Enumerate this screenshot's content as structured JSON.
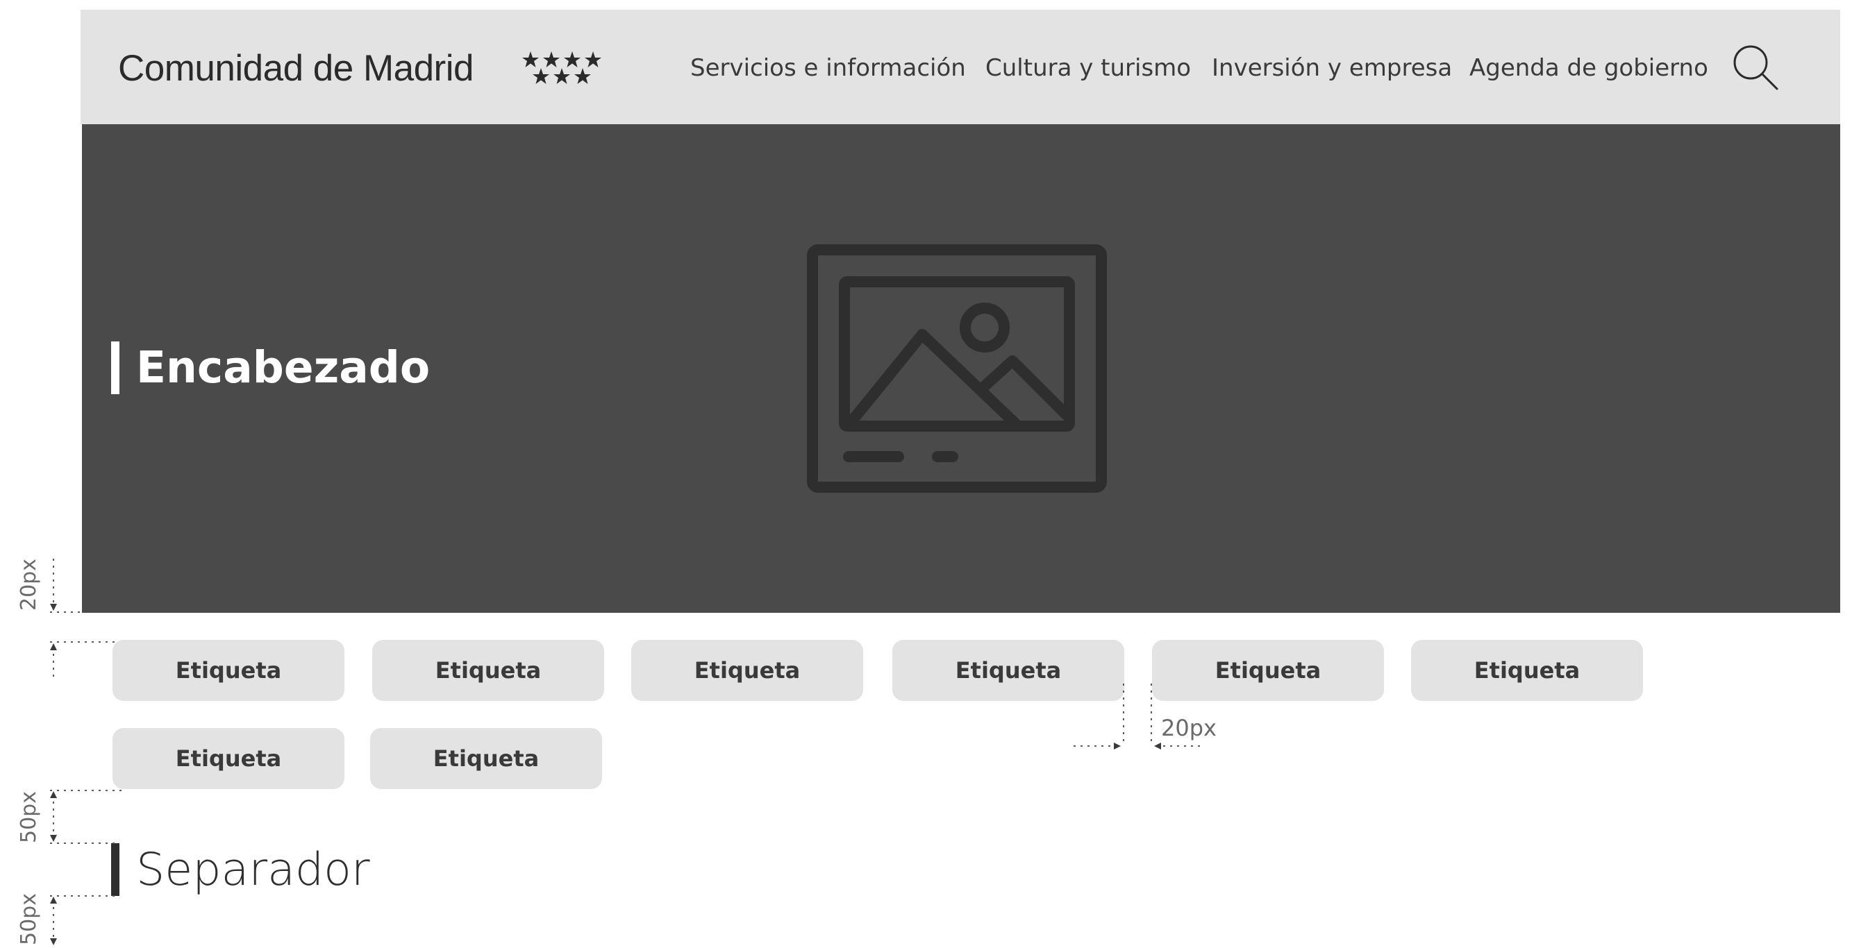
{
  "header": {
    "brand": "Comunidad de Madrid",
    "nav": [
      "Servicios e información",
      "Cultura y turismo",
      "Inversión y empresa",
      "Agenda de gobierno"
    ]
  },
  "hero": {
    "title": "Encabezado"
  },
  "tags": [
    "Etiqueta",
    "Etiqueta",
    "Etiqueta",
    "Etiqueta",
    "Etiqueta",
    "Etiqueta",
    "Etiqueta",
    "Etiqueta"
  ],
  "separator": {
    "title": "Separador"
  },
  "annotations": {
    "hero_to_tags": "20px",
    "tag_gap": "20px",
    "tags_to_separator": "50px",
    "separator_bottom": "50px"
  },
  "colors": {
    "header_bg": "#e3e3e3",
    "hero_bg": "#4a4a4a",
    "tag_bg": "#e3e3e3",
    "text_dark": "#2e2e2e"
  },
  "icons": {
    "search": "search-icon",
    "hero_image": "image-placeholder-icon",
    "brand_stars": "stars-icon"
  }
}
